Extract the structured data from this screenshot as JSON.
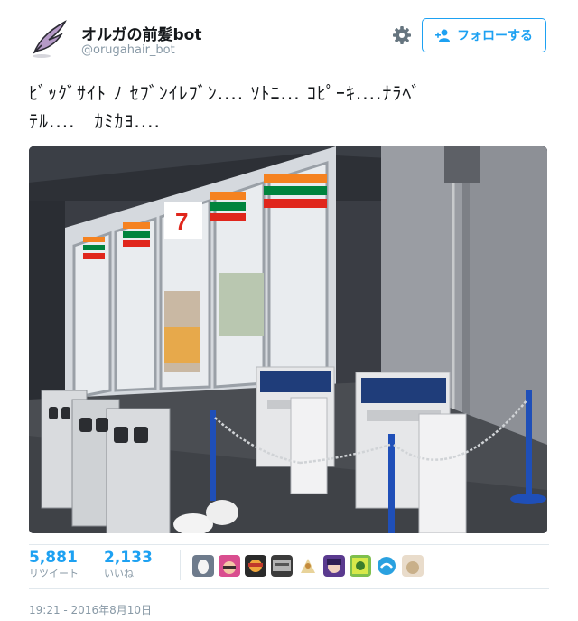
{
  "author": {
    "display_name": "オルガの前髪bot",
    "handle": "@orugahair_bot"
  },
  "header": {
    "settings_icon": "gear-icon",
    "follow_label": "フォローする",
    "follow_icon": "add-user-icon"
  },
  "tweet": {
    "line1": "ﾋﾞｯｸﾞｻｲﾄ ﾉ ｾﾌﾞﾝｲﾚﾌﾞﾝ.... ｿﾄﾆ... ｺﾋﾟｰｷ....ﾅﾗﾍﾞ",
    "line2": "ﾃﾙ....　ｶﾐｶﾖ...."
  },
  "stats": {
    "retweets": "5,881",
    "retweets_label": "リツイート",
    "likes": "2,133",
    "likes_label": "いいね"
  },
  "timestamp": "19:21 - 2016年8月10日",
  "colors": {
    "accent": "#1da1f2",
    "muted": "#8899a6",
    "border": "#e1e8ed"
  }
}
